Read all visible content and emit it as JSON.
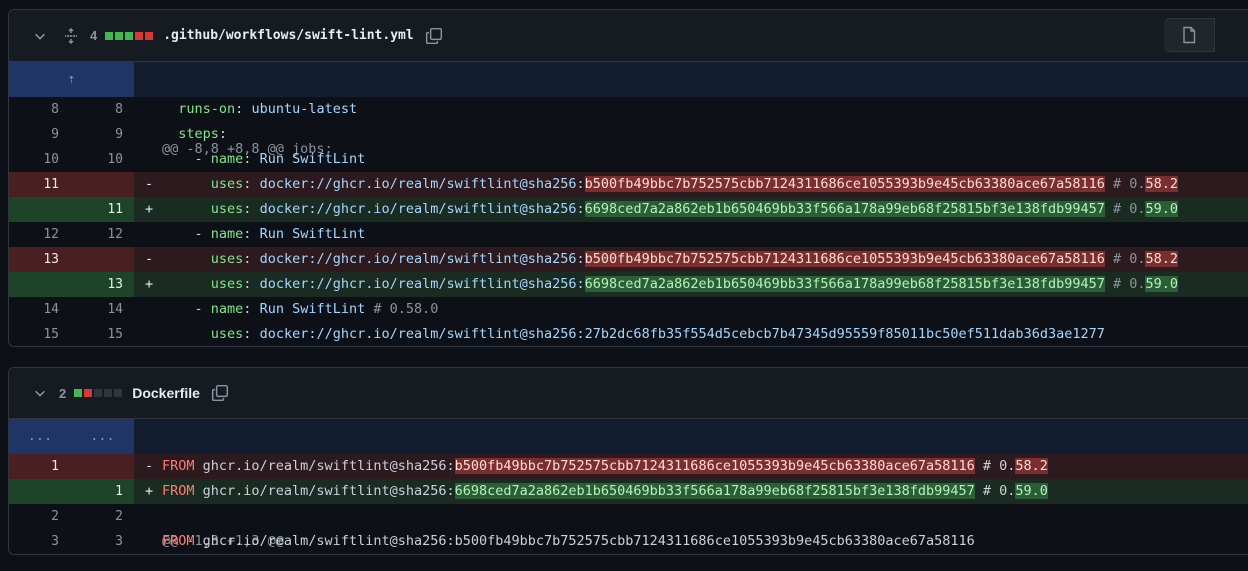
{
  "files": [
    {
      "changes": "4",
      "blocks": [
        "#3fb950",
        "#3fb950",
        "#3fb950",
        "#da3633",
        "#da3633"
      ],
      "name": ".github/workflows/swift-lint.yml",
      "hunk_header": "@@ -8,8 +8,8 @@ jobs:",
      "expand_glyph": "⇡",
      "lines": [
        {
          "type": "ctx",
          "a": "8",
          "b": "8",
          "indent": "  ",
          "key": "runs-on",
          "sep": ": ",
          "val": "ubuntu-latest"
        },
        {
          "type": "ctx",
          "a": "9",
          "b": "9",
          "indent": "  ",
          "key": "steps",
          "sep": ":",
          "val": ""
        },
        {
          "type": "ctx",
          "a": "10",
          "b": "10",
          "indent": "    - ",
          "key": "name",
          "sep": ": ",
          "val": "Run SwiftLint"
        },
        {
          "type": "del",
          "a": "11",
          "b": "",
          "sign": "-",
          "indent": "      ",
          "key": "uses",
          "sep": ": ",
          "pre": "docker://ghcr.io/realm/swiftlint@sha256:",
          "hash": "b500fb49bbc7b752575cbb7124311686ce1055393b9e45cb63380ace67a58116",
          "cmt": " # 0.",
          "ver": "58.2"
        },
        {
          "type": "add",
          "a": "",
          "b": "11",
          "sign": "+",
          "indent": "      ",
          "key": "uses",
          "sep": ": ",
          "pre": "docker://ghcr.io/realm/swiftlint@sha256:",
          "hash": "6698ced7a2a862eb1b650469bb33f566a178a99eb68f25815bf3e138fdb99457",
          "cmt": " # 0.",
          "ver": "59.0"
        },
        {
          "type": "ctx",
          "a": "12",
          "b": "12",
          "indent": "    - ",
          "key": "name",
          "sep": ": ",
          "val": "Run SwiftLint"
        },
        {
          "type": "del",
          "a": "13",
          "b": "",
          "sign": "-",
          "indent": "      ",
          "key": "uses",
          "sep": ": ",
          "pre": "docker://ghcr.io/realm/swiftlint@sha256:",
          "hash": "b500fb49bbc7b752575cbb7124311686ce1055393b9e45cb63380ace67a58116",
          "cmt": " # 0.",
          "ver": "58.2"
        },
        {
          "type": "add",
          "a": "",
          "b": "13",
          "sign": "+",
          "indent": "      ",
          "key": "uses",
          "sep": ": ",
          "pre": "docker://ghcr.io/realm/swiftlint@sha256:",
          "hash": "6698ced7a2a862eb1b650469bb33f566a178a99eb68f25815bf3e138fdb99457",
          "cmt": " # 0.",
          "ver": "59.0"
        },
        {
          "type": "ctx",
          "a": "14",
          "b": "14",
          "indent": "    - ",
          "key": "name",
          "sep": ": ",
          "val": "Run SwiftLint",
          "cmt": " # 0.58.0"
        },
        {
          "type": "ctx",
          "a": "15",
          "b": "15",
          "indent": "      ",
          "key": "uses",
          "sep": ": ",
          "val": "docker://ghcr.io/realm/swiftlint@sha256:27b2dc68fb35f554d5cebcb7b47345d95559f85011bc50ef511dab36d3ae1277"
        }
      ]
    },
    {
      "changes": "2",
      "blocks": [
        "#3fb950",
        "#da3633",
        "#30363d",
        "#30363d",
        "#30363d"
      ],
      "name": "Dockerfile",
      "hunk_header": "@@ -1,3 +1,3 @@",
      "expand_a": "...",
      "expand_b": "...",
      "lines": [
        {
          "type": "del",
          "a": "1",
          "b": "",
          "sign": "-",
          "kw": "FROM",
          "pre": " ghcr.io/realm/swiftlint@sha256:",
          "hash": "b500fb49bbc7b752575cbb7124311686ce1055393b9e45cb63380ace67a58116",
          "cmt": " # 0.",
          "ver": "58.2"
        },
        {
          "type": "add",
          "a": "",
          "b": "1",
          "sign": "+",
          "kw": "FROM",
          "pre": " ghcr.io/realm/swiftlint@sha256:",
          "hash": "6698ced7a2a862eb1b650469bb33f566a178a99eb68f25815bf3e138fdb99457",
          "cmt": " # 0.",
          "ver": "59.0"
        },
        {
          "type": "ctx",
          "a": "2",
          "b": "2",
          "kw": "",
          "pre": ""
        },
        {
          "type": "ctx",
          "a": "3",
          "b": "3",
          "kw": "FROM",
          "pre": " ghcr.io/realm/swiftlint@sha256:b500fb49bbc7b752575cbb7124311686ce1055393b9e45cb63380ace67a58116"
        }
      ]
    }
  ]
}
